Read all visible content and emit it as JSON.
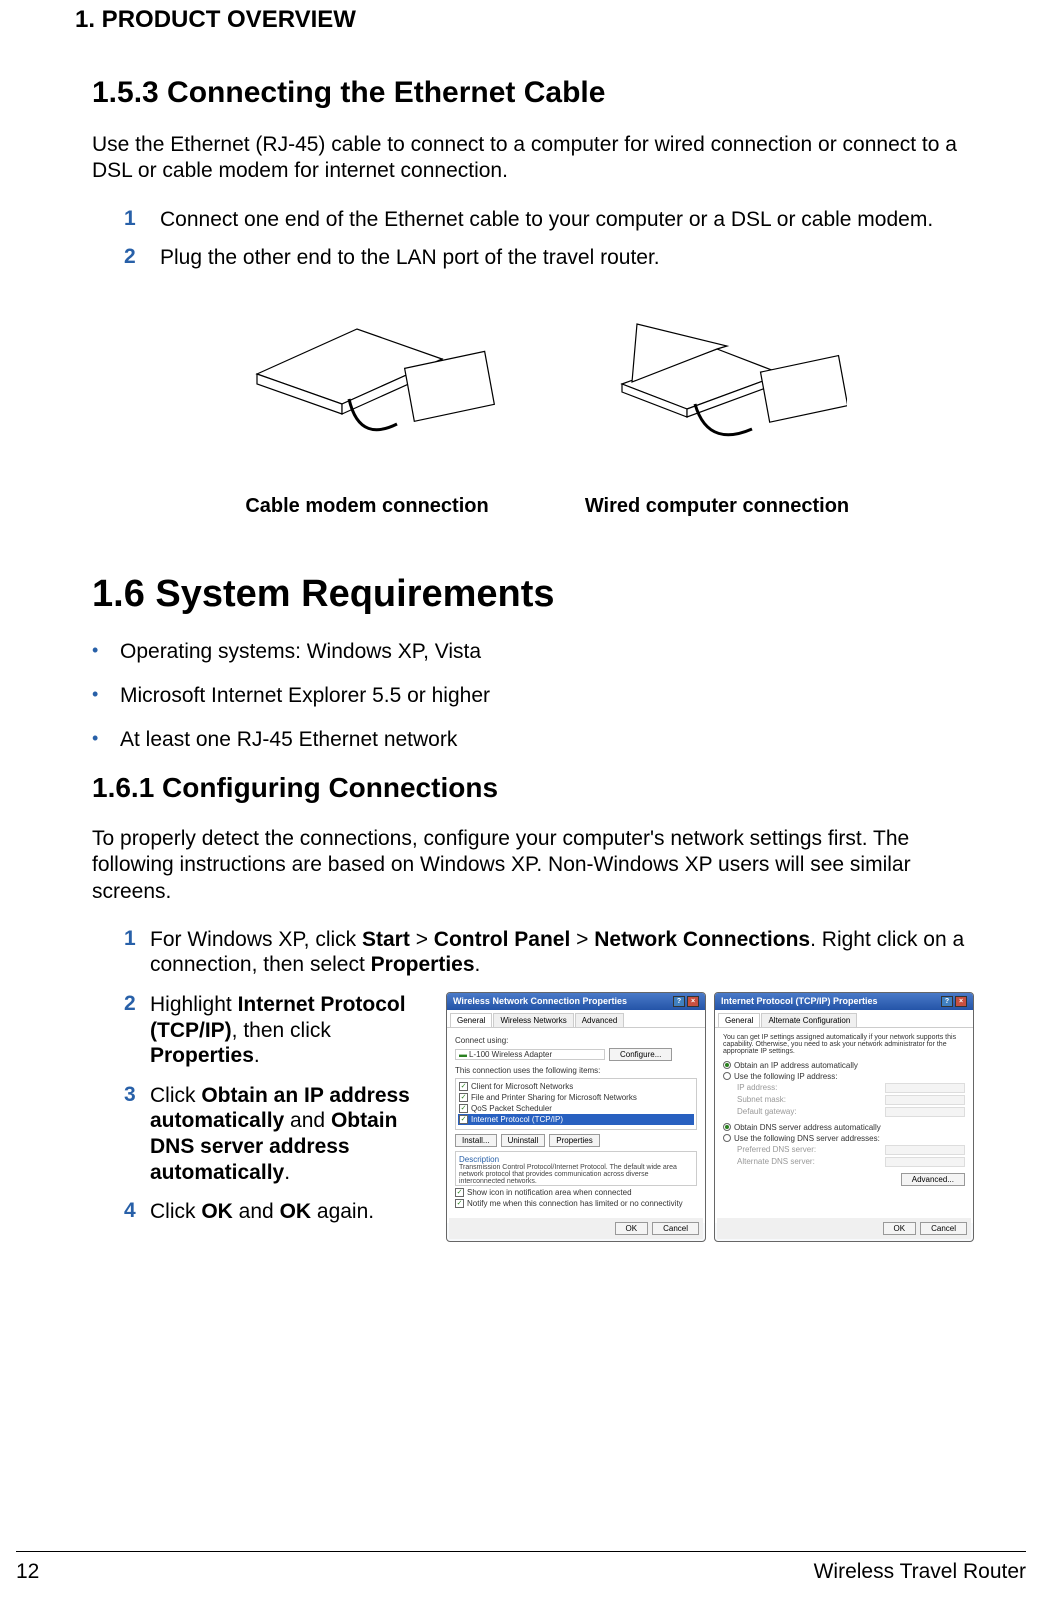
{
  "chapter_header": "1.  PRODUCT OVERVIEW",
  "section_153": {
    "heading": "1.5.3 Connecting the Ethernet Cable",
    "intro": "Use the Ethernet (RJ-45) cable to connect to a computer for wired connection or connect to a DSL or cable modem for internet connection.",
    "steps": [
      "Connect one end of the Ethernet cable to your computer or a DSL or cable modem.",
      "Plug the other end to the LAN port of the travel router."
    ],
    "fig_captions": {
      "left": "Cable modem connection",
      "right": "Wired computer connection"
    }
  },
  "section_16": {
    "heading": "1.6 System Requirements",
    "bullets": [
      "Operating systems: Windows XP, Vista",
      "Microsoft Internet Explorer 5.5 or higher",
      "At least one RJ-45 Ethernet network"
    ]
  },
  "section_161": {
    "heading": "1.6.1 Configuring Connections",
    "intro": "To properly detect the connections, configure your computer's network settings first. The following instructions are based on Windows XP. Non-Windows XP users will see similar screens.",
    "step1": {
      "num": "1",
      "pre": "For Windows XP, click ",
      "b1": "Start",
      "sep1": " > ",
      "b2": "Control Panel",
      "sep2": " > ",
      "b3": "Network Connections",
      "post1": ". Right click on a connection, then select ",
      "b4": "Properties",
      "post2": "."
    },
    "step2": {
      "num": "2",
      "pre": "Highlight ",
      "b1": "Internet Protocol (TCP/IP)",
      "mid": ", then click ",
      "b2": "Properties",
      "post": "."
    },
    "step3": {
      "num": "3",
      "pre": "Click ",
      "b1": "Obtain an IP address automatically",
      "mid": " and ",
      "b2": "Obtain DNS server address automatically",
      "post": "."
    },
    "step4": {
      "num": "4",
      "pre": "Click ",
      "b1": "OK",
      "mid": " and ",
      "b2": "OK",
      "post": " again."
    }
  },
  "dialog1": {
    "title": "Wireless Network Connection Properties",
    "tabs": [
      "General",
      "Wireless Networks",
      "Advanced"
    ],
    "connect_using": "Connect using:",
    "adapter": "L-100 Wireless Adapter",
    "config_btn": "Configure...",
    "uses_following": "This connection uses the following items:",
    "items": [
      "Client for Microsoft Networks",
      "File and Printer Sharing for Microsoft Networks",
      "QoS Packet Scheduler",
      "Internet Protocol (TCP/IP)"
    ],
    "install": "Install...",
    "uninstall": "Uninstall",
    "properties": "Properties",
    "desc_title": "Description",
    "desc": "Transmission Control Protocol/Internet Protocol. The default wide area network protocol that provides communication across diverse interconnected networks.",
    "show_icon": "Show icon in notification area when connected",
    "notify": "Notify me when this connection has limited or no connectivity",
    "ok": "OK",
    "cancel": "Cancel"
  },
  "dialog2": {
    "title": "Internet Protocol (TCP/IP) Properties",
    "tabs": [
      "General",
      "Alternate Configuration"
    ],
    "intro": "You can get IP settings assigned automatically if your network supports this capability. Otherwise, you need to ask your network administrator for the appropriate IP settings.",
    "obtain_ip": "Obtain an IP address automatically",
    "use_ip": "Use the following IP address:",
    "ip_addr": "IP address:",
    "subnet": "Subnet mask:",
    "gateway": "Default gateway:",
    "obtain_dns": "Obtain DNS server address automatically",
    "use_dns": "Use the following DNS server addresses:",
    "pref_dns": "Preferred DNS server:",
    "alt_dns": "Alternate DNS server:",
    "advanced": "Advanced...",
    "ok": "OK",
    "cancel": "Cancel"
  },
  "footer": {
    "page": "12",
    "product": "Wireless Travel Router"
  }
}
